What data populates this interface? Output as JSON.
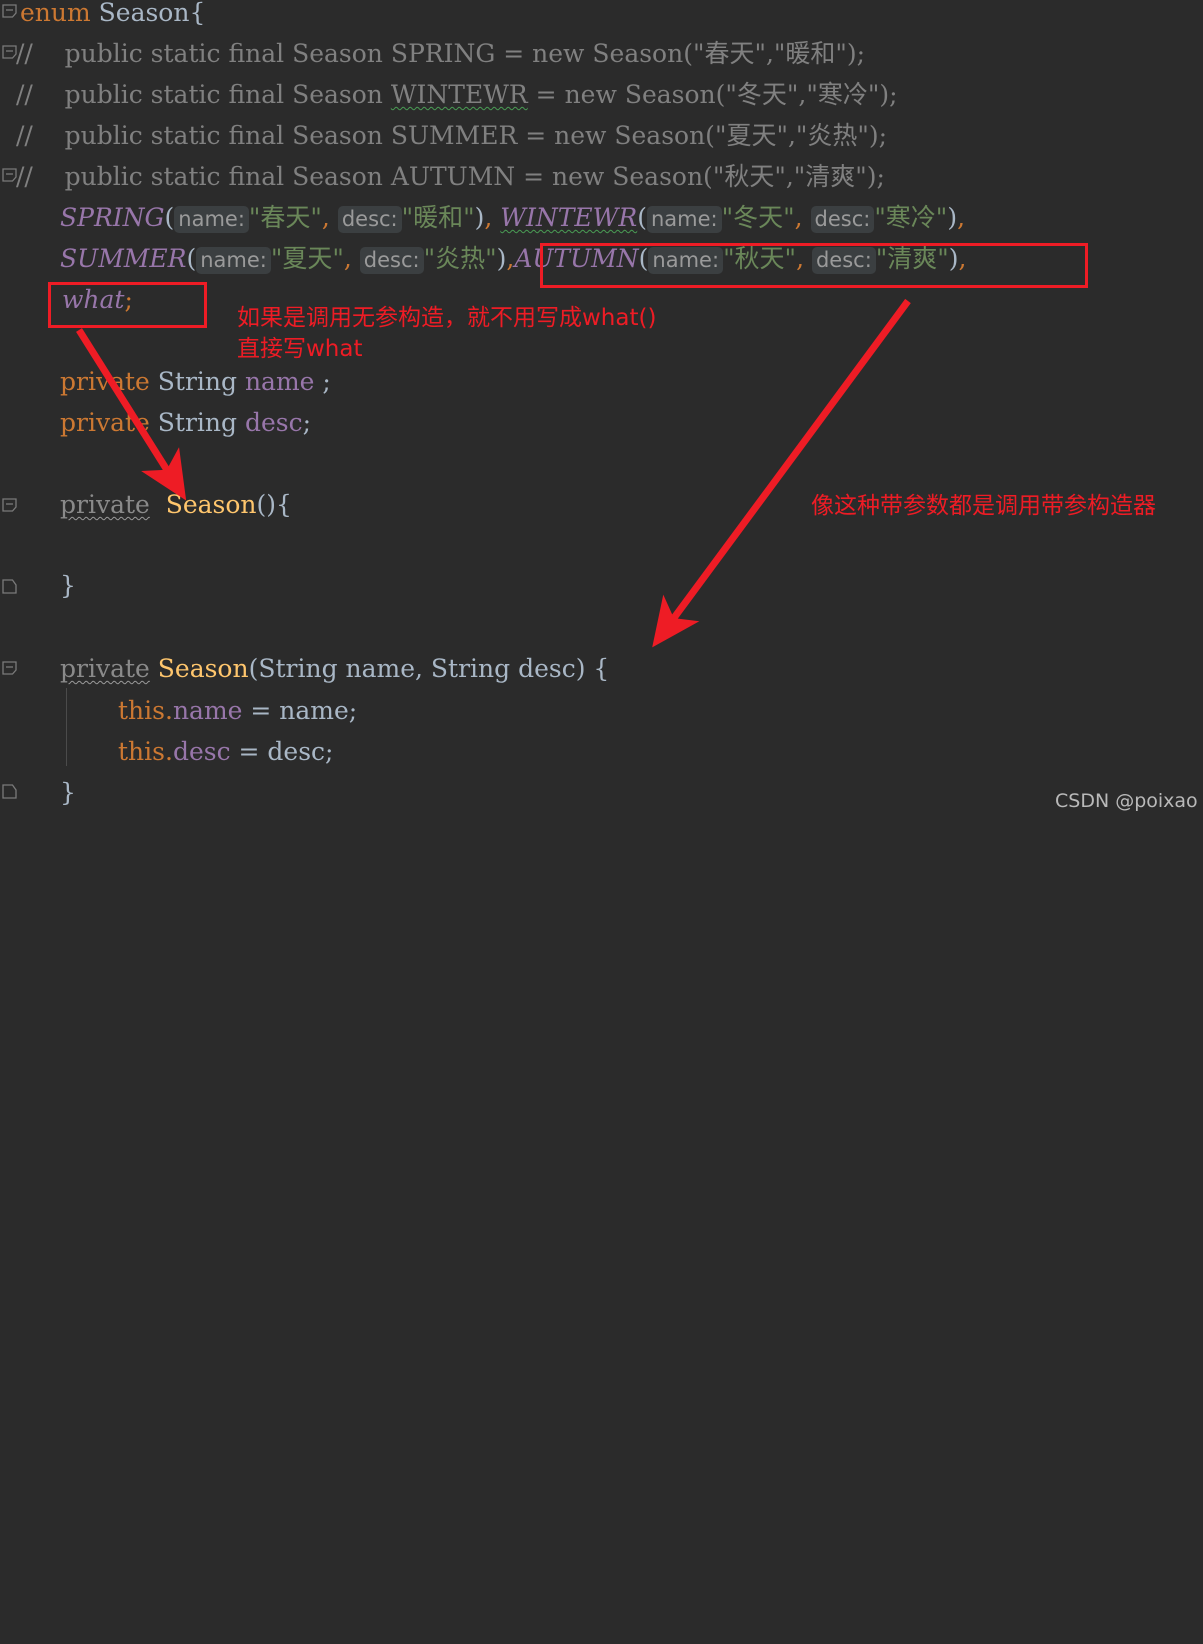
{
  "editor": {
    "background": "#2b2b2b",
    "accent_red": "#ee1c25",
    "string_color": "#6a8759",
    "keyword_color": "#cc7832",
    "field_color": "#9876aa",
    "method_color": "#ffc66d",
    "plain_color": "#a9b7c6",
    "comment_color": "#808080",
    "hint_bg": "#3b3f41"
  },
  "code": {
    "line01": {
      "kw": "enum",
      "type": " Season",
      "brace": "{"
    },
    "line02": {
      "comment": "//    public static final Season SPRING = new Season(",
      "s1": "\"春天\"",
      "c1": ",",
      "s2": "\"暖和\"",
      "tail": ");"
    },
    "line03": {
      "comment": "//    public static final Season ",
      "ident": "WINTEWR",
      "mid": " = new Season(",
      "s1": "\"冬天\"",
      "c1": ",",
      "s2": "\"寒冷\"",
      "tail": ");"
    },
    "line04": {
      "comment": "//    public static final Season SUMMER = new Season(",
      "s1": "\"夏天\"",
      "c1": ",",
      "s2": "\"炎热\"",
      "tail": ");"
    },
    "line05": {
      "comment": "//    public static final Season AUTUMN = new Season(",
      "s1": "\"秋天\"",
      "c1": ",",
      "s2": "\"清爽\"",
      "tail": ");"
    },
    "line06": {
      "const1": "SPRING",
      "open1": "(",
      "hint1": "name:",
      "str1": "\"春天\"",
      "comma1": ",",
      "hint2": "desc:",
      "str2": "\"暖和\"",
      "close1": ")",
      "comma2": ",",
      "const2": "WINTEWR",
      "open2": "(",
      "hint3": "name:",
      "str3": "\"冬天\"",
      "comma3": ",",
      "hint4": "desc:",
      "str4": "\"寒冷\"",
      "close2": ")",
      "comma4": ","
    },
    "line07": {
      "const1": "SUMMER",
      "open1": "(",
      "hint1": "name:",
      "str1": "\"夏天\"",
      "comma1": ",",
      "hint2": "desc:",
      "str2": "\"炎热\"",
      "close1": ")",
      "comma2": ",",
      "const2": "AUTUMN",
      "open2": "(",
      "hint3": "name:",
      "str3": "\"秋天\"",
      "comma3": ",",
      "hint4": "desc:",
      "str4": "\"清爽\"",
      "close2": ")",
      "comma4": ","
    },
    "line08": {
      "const": "what",
      "semi": ";"
    },
    "line09": {
      "kw": "private",
      "type": " String ",
      "field": "name",
      "tail": " ;"
    },
    "line10": {
      "kw": "private",
      "type": " String ",
      "field": "desc",
      "tail": ";"
    },
    "line11": {
      "kw": "private",
      "method": "  Season",
      "tail": "(){"
    },
    "line12": {
      "brace": "}"
    },
    "line13": {
      "kw": "private",
      "method": " Season",
      "sig": "(String name, String desc) {"
    },
    "line14": {
      "kw": "this",
      "dot": ".",
      "field": "name",
      "tail": " = name;"
    },
    "line15": {
      "kw": "this",
      "dot": ".",
      "field": "desc",
      "tail": " = desc;"
    },
    "line16": {
      "brace": "}"
    }
  },
  "annotations": {
    "note_left_line1": "如果是调用无参构造，就不用写成what()",
    "note_left_line2": "直接写what",
    "note_right": "像这种带参数都是调用带参构造器",
    "box_what_label": "what-highlight-box",
    "box_autumn_label": "autumn-highlight-box"
  },
  "watermark": {
    "text": "CSDN @poixao"
  }
}
